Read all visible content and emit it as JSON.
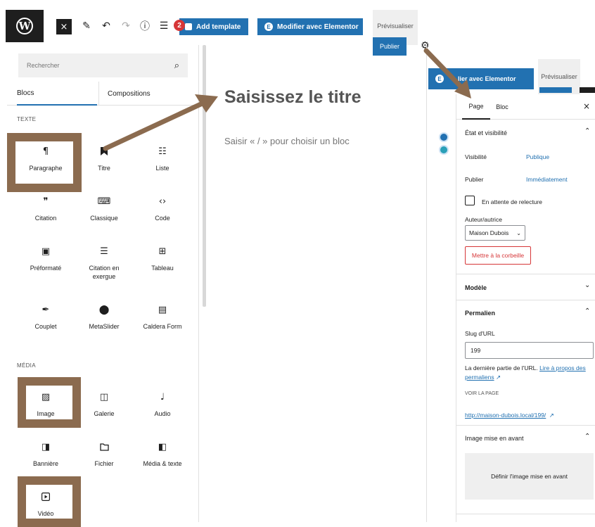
{
  "toolbar": {
    "wp_logo_letter": "W",
    "close_icon": "×",
    "edit_icon": "✎",
    "undo_icon": "↶",
    "redo_icon": "↷",
    "info_icon": "ⓘ",
    "list_view_icon": "☰",
    "notification_count": "2",
    "add_template_label": "Add template",
    "elementor_label": "Modifier avec Elementor",
    "preview_label": "Prévisualiser",
    "publish_label": "Publier",
    "settings_icon": "⚙"
  },
  "inserter": {
    "search_placeholder": "Rechercher",
    "search_icon": "⌕",
    "tabs": [
      "Blocs",
      "Compositions"
    ],
    "categories": {
      "text": "TEXTE",
      "media": "MÉDIA"
    },
    "text_blocks": [
      {
        "label": "Paragraphe",
        "icon": "¶"
      },
      {
        "label": "Titre",
        "icon": "🔖"
      },
      {
        "label": "Liste",
        "icon": "☷"
      },
      {
        "label": "Citation",
        "icon": "❞"
      },
      {
        "label": "Classique",
        "icon": "⌨"
      },
      {
        "label": "Code",
        "icon": "‹›"
      },
      {
        "label": "Préformaté",
        "icon": "▣"
      },
      {
        "label": "Citation en exergue",
        "icon": "☰"
      },
      {
        "label": "Tableau",
        "icon": "⊞"
      },
      {
        "label": "Couplet",
        "icon": "✒"
      },
      {
        "label": "MetaSlider",
        "icon": "⬤"
      },
      {
        "label": "Caldera Form",
        "icon": "▤"
      }
    ],
    "media_blocks": [
      {
        "label": "Image",
        "icon": "▨"
      },
      {
        "label": "Galerie",
        "icon": "◫"
      },
      {
        "label": "Audio",
        "icon": "♩"
      },
      {
        "label": "Bannière",
        "icon": "◨"
      },
      {
        "label": "Fichier",
        "icon": "🗀"
      },
      {
        "label": "Média & texte",
        "icon": "◧"
      },
      {
        "label": "Vidéo",
        "icon": "▶"
      }
    ]
  },
  "canvas": {
    "title_placeholder": "Saisissez le titre",
    "block_prompt": "Saisir « / » pour choisir un bloc"
  },
  "inset_toolbar": {
    "elementor_label": "lier avec Elementor",
    "preview_label": "Prévisualiser"
  },
  "sidebar": {
    "tabs": [
      "Page",
      "Bloc"
    ],
    "close_icon": "×",
    "status": {
      "heading": "État et visibilité",
      "visibility_label": "Visibilité",
      "visibility_value": "Publique",
      "publish_label": "Publier",
      "publish_value": "Immédiatement",
      "pending_review": "En attente de relecture",
      "author_label": "Auteur/autrice",
      "author_value": "Maison Dubois",
      "trash_label": "Mettre à la corbeille"
    },
    "template_heading": "Modèle",
    "permalink": {
      "heading": "Permalien",
      "slug_label": "Slug d'URL",
      "slug_value": "199",
      "help_text": "La dernière partie de l'URL.",
      "help_link": "Lire à propos des permaliens",
      "view_page_label": "VOIR LA PAGE",
      "url": "http://maison-dubois.local/199/"
    },
    "featured_image": {
      "heading": "Image mise en avant",
      "button_label": "Définir l'image mise en avant"
    }
  },
  "colors": {
    "accent": "#2271b1",
    "highlight": "#8b6b4f",
    "danger": "#d63638"
  }
}
